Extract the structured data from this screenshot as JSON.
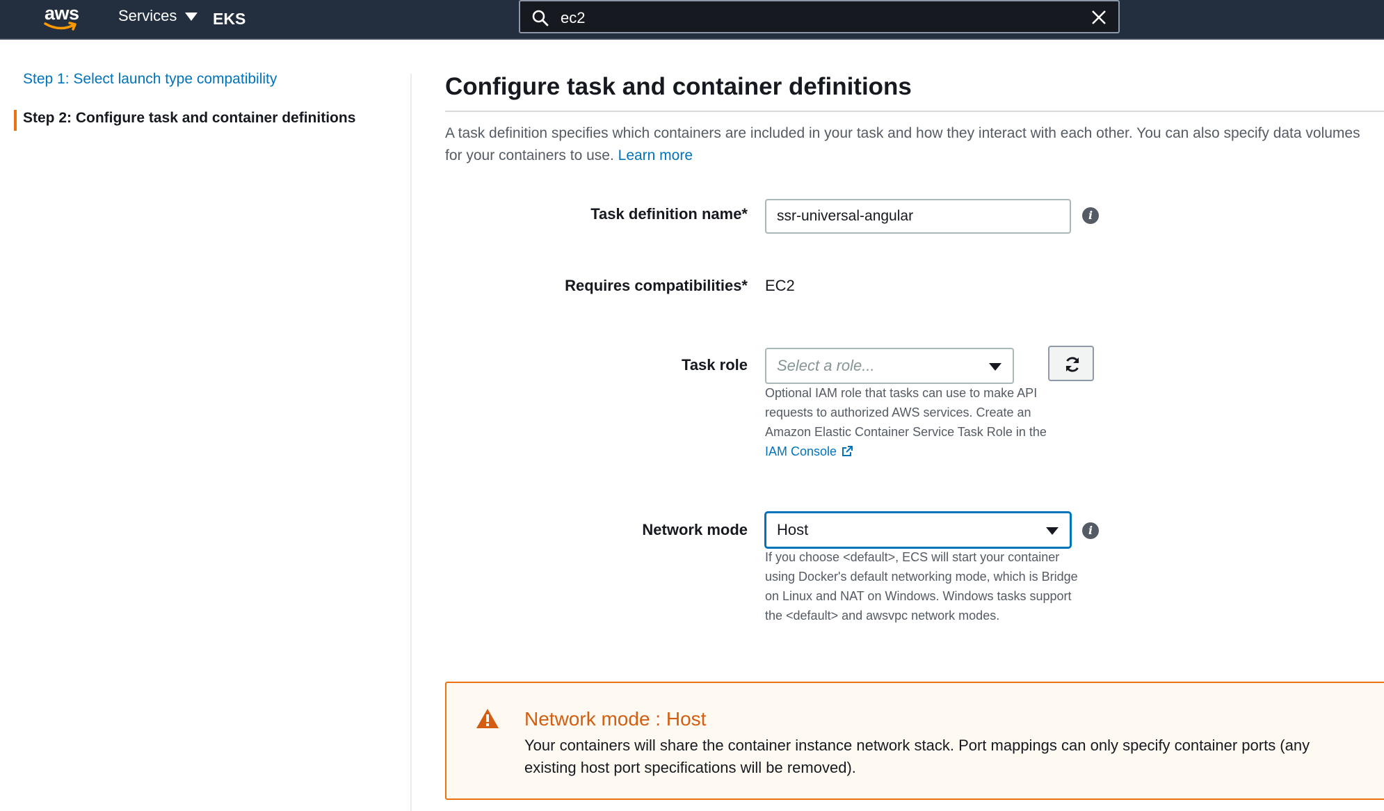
{
  "topnav": {
    "logo_text": "aws",
    "services_label": "Services",
    "pinned_service": "EKS",
    "search_value": "ec2"
  },
  "steps": [
    {
      "label": "Step 1: Select launch type compatibility",
      "active": false
    },
    {
      "label": "Step 2: Configure task and container definitions",
      "active": true
    }
  ],
  "main": {
    "title": "Configure task and container definitions",
    "intro": "A task definition specifies which containers are included in your task and how they interact with each other. You can also specify data volumes for your containers to use.",
    "learn_more": "Learn more"
  },
  "form": {
    "task_definition_name": {
      "label": "Task definition name*",
      "value": "ssr-universal-angular"
    },
    "requires_compatibilities": {
      "label": "Requires compatibilities*",
      "value": "EC2"
    },
    "task_role": {
      "label": "Task role",
      "placeholder": "Select a role...",
      "help": "Optional IAM role that tasks can use to make API requests to authorized AWS services. Create an Amazon Elastic Container Service Task Role in the",
      "help_link": "IAM Console"
    },
    "network_mode": {
      "label": "Network mode",
      "value": "Host",
      "help": "If you choose <default>, ECS will start your container using Docker's default networking mode, which is Bridge on Linux and NAT on Windows. Windows tasks support the <default> and awsvpc network modes."
    }
  },
  "alert": {
    "title": "Network mode : Host",
    "body": "Your containers will share the container instance network stack. Port mappings can only specify container ports (any existing host port specifications will be removed)."
  },
  "colors": {
    "nav_bg": "#232f3e",
    "link": "#0073bb",
    "accent_orange": "#ec7211",
    "warning_text": "#d35e11"
  },
  "icons": [
    "search-icon",
    "close-icon",
    "chevron-down-icon",
    "info-icon",
    "refresh-icon",
    "external-link-icon",
    "warning-icon"
  ]
}
